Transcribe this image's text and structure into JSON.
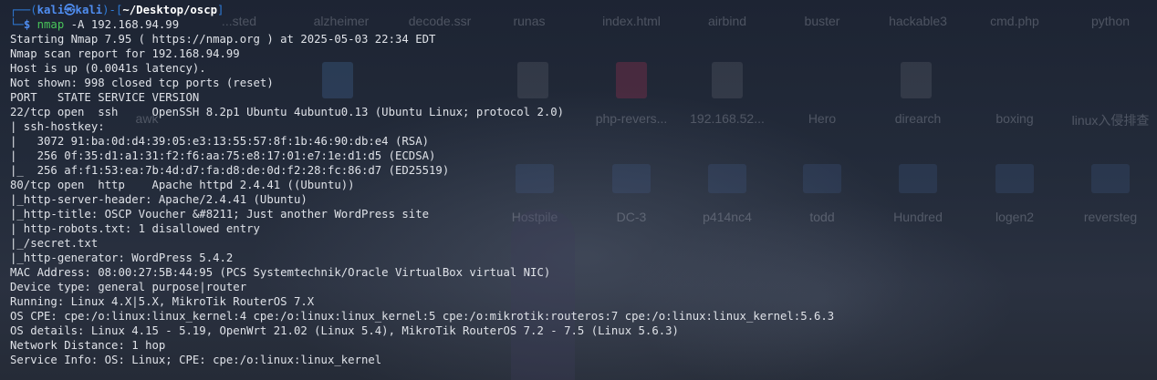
{
  "desktop": {
    "top_row": [
      "...sted",
      "alzheimer",
      "decode.ssr",
      "runas",
      "index.html",
      "airbind",
      "buster",
      "hackable3",
      "cmd.php",
      "python"
    ],
    "middle_row": [
      "awk",
      "php-revers...",
      "192.168.52...",
      "Hero",
      "direarch",
      "boxing",
      "linux入侵排查"
    ],
    "bottom_row": [
      "Hostpile",
      "DC-3",
      "p414nc4",
      "todd",
      "Hundred",
      "logen2",
      "reversteg"
    ]
  },
  "terminal": {
    "prompt": {
      "frame_top": "┌──(",
      "user": "kali㉿kali",
      "mid": ")-[",
      "cwd": "~/Desktop/oscp",
      "end": "]",
      "frame_bottom": "└─",
      "dollar": "$",
      "command": "nmap",
      "args": " -A 192.168.94.99"
    },
    "output": [
      "Starting Nmap 7.95 ( https://nmap.org ) at 2025-05-03 22:34 EDT",
      "Nmap scan report for 192.168.94.99",
      "Host is up (0.0041s latency).",
      "Not shown: 998 closed tcp ports (reset)",
      "PORT   STATE SERVICE VERSION",
      "22/tcp open  ssh     OpenSSH 8.2p1 Ubuntu 4ubuntu0.13 (Ubuntu Linux; protocol 2.0)",
      "| ssh-hostkey:",
      "|   3072 91:ba:0d:d4:39:05:e3:13:55:57:8f:1b:46:90:db:e4 (RSA)",
      "|   256 0f:35:d1:a1:31:f2:f6:aa:75:e8:17:01:e7:1e:d1:d5 (ECDSA)",
      "|_  256 af:f1:53:ea:7b:4d:d7:fa:d8:de:0d:f2:28:fc:86:d7 (ED25519)",
      "80/tcp open  http    Apache httpd 2.4.41 ((Ubuntu))",
      "|_http-server-header: Apache/2.4.41 (Ubuntu)",
      "|_http-title: OSCP Voucher &#8211; Just another WordPress site",
      "| http-robots.txt: 1 disallowed entry",
      "|_/secret.txt",
      "|_http-generator: WordPress 5.4.2",
      "MAC Address: 08:00:27:5B:44:95 (PCS Systemtechnik/Oracle VirtualBox virtual NIC)",
      "Device type: general purpose|router",
      "Running: Linux 4.X|5.X, MikroTik RouterOS 7.X",
      "OS CPE: cpe:/o:linux:linux_kernel:4 cpe:/o:linux:linux_kernel:5 cpe:/o:mikrotik:routeros:7 cpe:/o:linux:linux_kernel:5.6.3",
      "OS details: Linux 4.15 - 5.19, OpenWrt 21.02 (Linux 5.4), MikroTik RouterOS 7.2 - 7.5 (Linux 5.6.3)",
      "Network Distance: 1 hop",
      "Service Info: OS: Linux; CPE: cpe:/o:linux:linux_kernel"
    ]
  }
}
